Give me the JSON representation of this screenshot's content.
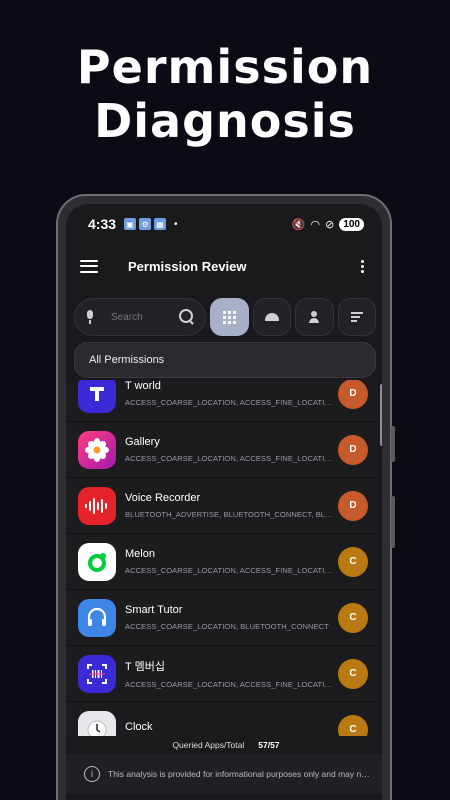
{
  "headline": {
    "line1": "Permission",
    "line2": "Diagnosis"
  },
  "statusbar": {
    "time": "4:33",
    "dot": "•",
    "battery": "100"
  },
  "appbar": {
    "title": "Permission Review"
  },
  "search": {
    "placeholder": "Search"
  },
  "dropdown": {
    "selected": "All Permissions"
  },
  "apps": [
    {
      "name": "T world",
      "perms": "ACCESS_COARSE_LOCATION, ACCESS_FINE_LOCATION",
      "grade": "D",
      "icon": "t-world-icon",
      "icon_color": "#3a2bd6",
      "grade_color": "#c75a2a"
    },
    {
      "name": "Gallery",
      "perms": "ACCESS_COARSE_LOCATION, ACCESS_FINE_LOCATION",
      "grade": "D",
      "icon": "gallery-flower-icon",
      "icon_color": "#b8149b",
      "grade_color": "#c75a2a"
    },
    {
      "name": "Voice Recorder",
      "perms": "BLUETOOTH_ADVERTISE, BLUETOOTH_CONNECT, BLUETOOTH_SCAN",
      "grade": "D",
      "icon": "voice-waveform-icon",
      "icon_color": "#e5232a",
      "grade_color": "#c75a2a"
    },
    {
      "name": "Melon",
      "perms": "ACCESS_COARSE_LOCATION, ACCESS_FINE_LOCATION",
      "grade": "C",
      "icon": "melon-icon",
      "icon_color": "#ffffff",
      "grade_color": "#b97a14"
    },
    {
      "name": "Smart Tutor",
      "perms": "ACCESS_COARSE_LOCATION, BLUETOOTH_CONNECT",
      "grade": "C",
      "icon": "headset-icon",
      "icon_color": "#3d86e6",
      "grade_color": "#b97a14"
    },
    {
      "name": "T 멤버십",
      "perms": "ACCESS_COARSE_LOCATION, ACCESS_FINE_LOCATION",
      "grade": "C",
      "icon": "barcode-scan-icon",
      "icon_color": "#3a2bd6",
      "grade_color": "#b97a14"
    },
    {
      "name": "Clock",
      "perms": "",
      "grade": "C",
      "icon": "clock-icon",
      "icon_color": "#e8e8ec",
      "grade_color": "#b97a14"
    }
  ],
  "summary": {
    "label": "Queried Apps/Total",
    "value": "57/57"
  },
  "footer": {
    "message": "This analysis is provided for informational purposes only and may not be fully accurate."
  }
}
